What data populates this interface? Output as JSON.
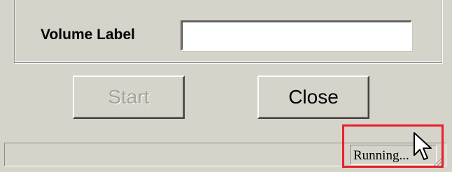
{
  "form": {
    "volume_label": "Volume Label",
    "volume_value": ""
  },
  "buttons": {
    "start_label": "Start",
    "start_enabled": false,
    "close_label": "Close"
  },
  "statusbar": {
    "status_text": "Running..."
  },
  "annotation": {
    "highlight_color": "#e8202a"
  },
  "icons": {
    "cursor": "arrow-cursor-icon",
    "grip": "resize-grip-icon"
  }
}
